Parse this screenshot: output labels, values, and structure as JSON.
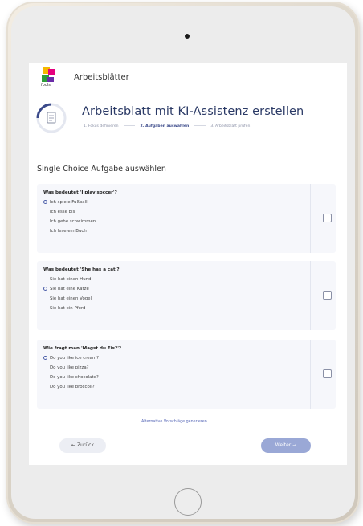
{
  "app": {
    "title": "Arbeitsblätter",
    "logo_text": "fools"
  },
  "wizard": {
    "title": "Arbeitsblatt mit KI-Assistenz erstellen",
    "steps": [
      "1. Fokus definieren",
      "2. Aufgaben auswählen",
      "3. Arbeitsblatt prüfen"
    ],
    "active_step": 2
  },
  "section": {
    "title": "Single Choice Aufgabe auswählen"
  },
  "questions": [
    {
      "question": "Was bedeutet 'I play soccer'?",
      "options": [
        "Ich spiele Fußball",
        "Ich esse Eis",
        "Ich gehe schwimmen",
        "Ich lese ein Buch"
      ],
      "selected": 0
    },
    {
      "question": "Was bedeutet 'She has a cat'?",
      "options": [
        "Sie hat einen Hund",
        "Sie hat eine Katze",
        "Sie hat einen Vogel",
        "Sie hat ein Pferd"
      ],
      "selected": 1
    },
    {
      "question": "Wie fragt man 'Magst du Eis?'?",
      "options": [
        "Do you like ice cream?",
        "Do you like pizza?",
        "Do you like chocolate?",
        "Do you like broccoli?"
      ],
      "selected": 0
    }
  ],
  "actions": {
    "alternative_link": "Alternative Vorschläge generieren",
    "back_label": "← Zurück",
    "next_label": "Weiter →"
  },
  "colors": {
    "accent": "#2b3a66",
    "primary_button": "#9aa8d6",
    "card_bg": "#f6f7fb"
  }
}
